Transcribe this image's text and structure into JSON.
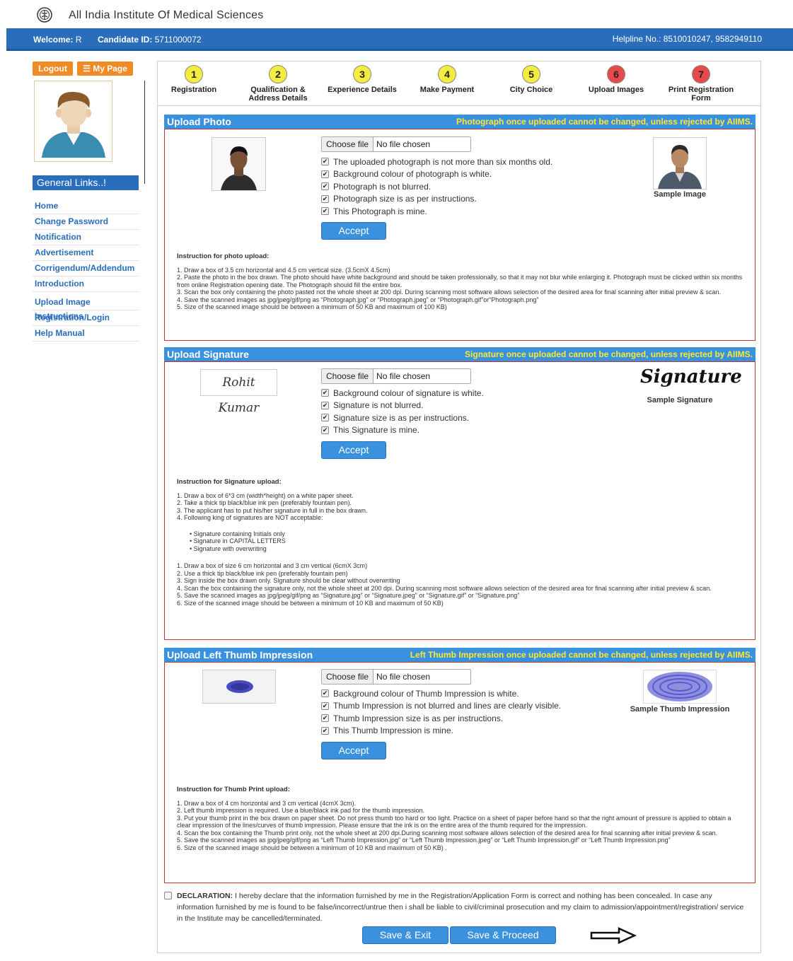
{
  "header": {
    "site_title": "All India Institute Of Medical Sciences",
    "welcome_label": "Welcome:",
    "welcome_value": "R",
    "candidate_label": "Candidate ID:",
    "candidate_value": "5711000072",
    "helpline": "Helpline No.: 8510010247, 9582949110"
  },
  "sidebar": {
    "logout": "Logout",
    "mypage": "My Page",
    "general_links": "General Links..!",
    "items": [
      {
        "label": "Home"
      },
      {
        "label": "Change Password"
      },
      {
        "label": "Notification"
      },
      {
        "label": "Advertisement"
      },
      {
        "label": "Corrigendum/Addendum"
      },
      {
        "label": "Introduction"
      },
      {
        "label": "Upload Image Instructions"
      },
      {
        "label": "Registration/Login"
      },
      {
        "label": "Help Manual"
      }
    ]
  },
  "steps": [
    {
      "num": "1",
      "label": "Registration",
      "state": "done"
    },
    {
      "num": "2",
      "label": "Qualification & Address Details",
      "state": "done"
    },
    {
      "num": "3",
      "label": "Experience Details",
      "state": "done"
    },
    {
      "num": "4",
      "label": "Make Payment",
      "state": "done"
    },
    {
      "num": "5",
      "label": "City Choice",
      "state": "done"
    },
    {
      "num": "6",
      "label": "Upload Images",
      "state": "pending"
    },
    {
      "num": "7",
      "label": "Print Registration Form",
      "state": "pending"
    }
  ],
  "file_input": {
    "button": "Choose file",
    "status": "No file chosen"
  },
  "photo": {
    "title": "Upload Photo",
    "warning": "Photograph once uploaded cannot be changed, unless rejected by AIIMS.",
    "checks": [
      "The uploaded photograph is not more than six months old.",
      "Background colour of photograph is white.",
      "Photograph is not blurred.",
      "Photograph size is as per instructions.",
      "This Photograph is mine."
    ],
    "accept": "Accept",
    "sample_label": "Sample Image",
    "instr_title": "Instruction for photo upload:",
    "instr": [
      "1. Draw a box of 3.5 cm horizontal and 4.5 cm vertical size. (3.5cmX 4.5cm)",
      "2. Paste the photo in the box drawn. The photo should have white background and should be taken professionally, so that it may not blur while enlarging it. Photograph must be clicked within six months from online Registration opening date. The Photograph should fill the entire box.",
      "3. Scan the box only containing the photo pasted not the whole sheet at 200 dpi. During scanning most software allows selection of the desired area for final scanning after initial preview & scan.",
      "4. Save the scanned images as jpg/jpeg/gif/png as “Photograph.jpg” or “Photograph.jpeg” or “Photograph.gif”or“Photograph.png”",
      "5. Size of the scanned image should be between a minimum of 50 KB and maximum of 100 KB)"
    ]
  },
  "signature": {
    "title": "Upload Signature",
    "warning": "Signature once uploaded cannot be changed, unless rejected by AIIMS.",
    "uploaded_text": "Rohit Kumar",
    "sample_text": "Signature",
    "checks": [
      "Background colour of signature is white.",
      "Signature is not blurred.",
      "Signature size is as per instructions.",
      "This Signature is mine."
    ],
    "accept": "Accept",
    "sample_label": "Sample Signature",
    "instr_title": "Instruction for Signature upload:",
    "instr_a": [
      "1. Draw a box of 6*3 cm (width*height) on a white paper sheet.",
      "2. Take a thick tip black/blue ink pen (preferably fountain pen).",
      "3. The applicant has to put his/her signature in full in the box drawn.",
      "4. Following king of signatures are NOT acceptable:"
    ],
    "bullets": [
      "Signature containing Initials only",
      "Signature in CAPITAL LETTERS",
      "Signature with overwriting"
    ],
    "instr_b": [
      "1. Draw a box of size 6 cm horizontal and 3 cm vertical (6cmX 3cm)",
      "2. Use a thick tip black/blue ink pen (preferably fountain pen)",
      "3. Sign inside the box drawn only. Signature should be clear without overwriting",
      "4. Scan the box containing the signature only, not the whole sheet at 200 dpi. During scanning most software allows selection of the desired area for final scanning after initial preview & scan.",
      "5. Save the scanned images as jpg/jpeg/gif/png as “Signature.jpg” or “Signature.jpeg” or “Signature.gif” or “Signature.png”",
      "6. Size of the scanned image should be between a minimum of 10 KB and maximum of 50 KB)"
    ]
  },
  "thumb": {
    "title": "Upload Left Thumb Impression",
    "warning": "Left Thumb Impression once uploaded cannot be changed, unless rejected by AIIMS.",
    "checks": [
      "Background colour of Thumb Impression is white.",
      "Thumb Impression is not blurred and lines are clearly visible.",
      "Thumb Impression size is as per instructions.",
      "This Thumb Impression is mine."
    ],
    "accept": "Accept",
    "sample_label": "Sample Thumb Impression",
    "instr_title": "Instruction for Thumb Print upload:",
    "instr": [
      "1. Draw a box of 4 cm horizontal and 3 cm vertical (4cmX 3cm).",
      "2. Left thumb impression is required. Use a blue/black ink pad for the thumb impression.",
      "3. Put your thumb print in the box drawn on paper sheet. Do not press thumb too hard or too light. Practice on a sheet of paper before hand so that the right amount of pressure is applied to obtain a clear impression of the lines/curves of thumb impression. Please ensure that the ink is on the entire area of the thumb required for the impression.",
      "4. Scan the box containing the Thumb print only, not the whole sheet at 200 dpi.During scanning most software allows selection of the desired area for final scanning after initial preview & scan.",
      "5. Save the scanned images as jpg/jpeg/gif/png as “Left Thumb Impression.jpg” or “Left Thumb Impression.jpeg” or “Left Thumb Impression.gif” or “Left Thumb Impression.png”",
      "6. Size of the scanned image should be between a minimum of 10 KB and maximum of 50 KB) ."
    ]
  },
  "declaration": {
    "label": "DECLARATION:",
    "text": " I hereby declare that the information furnished by me in the Registration/Application Form is correct and nothing has been concealed. In case any information furnished by me is found to be false/incorrect/untrue then i shall be liable to civil/criminal prosecution and my claim to admission/appointment/registration/ service in the Institute may be cancelled/terminated."
  },
  "actions": {
    "save_exit": "Save & Exit",
    "save_proceed": "Save & Proceed"
  },
  "colors": {
    "primary": "#2a6ebb",
    "section": "#3a92de",
    "warning": "#ffe830",
    "orange": "#f08a24",
    "step_done": "#f5ec40",
    "step_pending": "#e74a4a",
    "border_red": "#c0392b"
  }
}
